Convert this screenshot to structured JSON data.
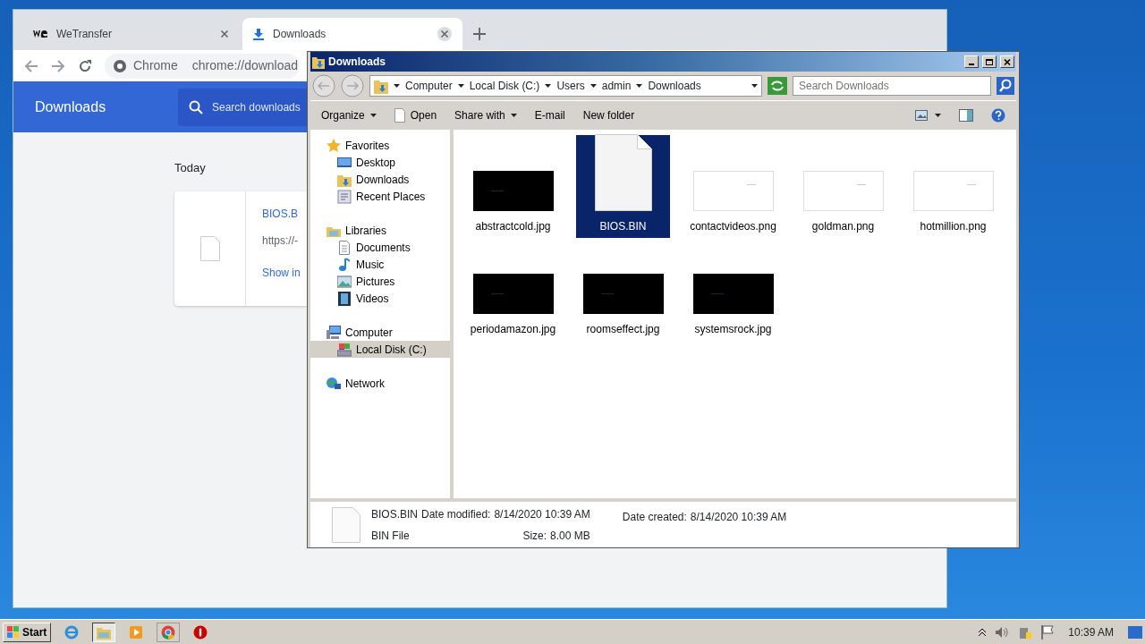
{
  "browser": {
    "tabs": [
      {
        "label": "WeTransfer",
        "kind": "wetransfer",
        "selected": false
      },
      {
        "label": "Downloads",
        "kind": "download",
        "selected": true
      }
    ],
    "address": {
      "scheme": "Chrome",
      "url": "chrome://download"
    },
    "header": {
      "title": "Downloads",
      "search_placeholder": "Search downloads"
    },
    "section": "Today",
    "download": {
      "name": "BIOS.B",
      "url": "https://-",
      "link": "Show in"
    }
  },
  "explorer": {
    "title": "Downloads",
    "breadcrumb": [
      "Computer",
      "Local Disk (C:)",
      "Users",
      "admin",
      "Downloads"
    ],
    "search_placeholder": "Search Downloads",
    "toolbar": [
      {
        "label": "Organize",
        "dropdown": true,
        "kind": "text"
      },
      {
        "label": "Open",
        "dropdown": false,
        "kind": "file"
      },
      {
        "label": "Share with",
        "dropdown": true,
        "kind": "text"
      },
      {
        "label": "E-mail",
        "dropdown": false,
        "kind": "text"
      },
      {
        "label": "New folder",
        "dropdown": false,
        "kind": "text"
      }
    ],
    "nav": [
      {
        "label": "Favorites",
        "kind": "star",
        "selected": false,
        "children": [
          {
            "label": "Desktop",
            "kind": "desktop",
            "selected": false
          },
          {
            "label": "Downloads",
            "kind": "folder",
            "selected": false
          },
          {
            "label": "Recent Places",
            "kind": "recent",
            "selected": false
          }
        ]
      },
      {
        "label": "Libraries",
        "kind": "library",
        "selected": false,
        "children": [
          {
            "label": "Documents",
            "kind": "document",
            "selected": false
          },
          {
            "label": "Music",
            "kind": "music",
            "selected": false
          },
          {
            "label": "Pictures",
            "kind": "pictures",
            "selected": false
          },
          {
            "label": "Videos",
            "kind": "video",
            "selected": false
          }
        ]
      },
      {
        "label": "Computer",
        "kind": "computer",
        "selected": false,
        "children": [
          {
            "label": "Local Disk (C:)",
            "kind": "disk",
            "selected": true
          }
        ]
      },
      {
        "label": "Network",
        "kind": "network",
        "selected": false
      }
    ],
    "files": [
      {
        "name": "abstractcold.jpg",
        "kind": "dark",
        "selected": false
      },
      {
        "name": "BIOS.BIN",
        "kind": "file",
        "selected": true
      },
      {
        "name": "contactvideos.png",
        "kind": "light",
        "selected": false
      },
      {
        "name": "goldman.png",
        "kind": "light",
        "selected": false
      },
      {
        "name": "hotmillion.png",
        "kind": "light",
        "selected": false
      },
      {
        "name": "periodamazon.jpg",
        "kind": "dark",
        "selected": false
      },
      {
        "name": "roomseffect.jpg",
        "kind": "dark",
        "selected": false
      },
      {
        "name": "systemsrock.jpg",
        "kind": "dark",
        "selected": false
      }
    ],
    "details": {
      "name": "BIOS.BIN",
      "type": "BIN File",
      "modified_label": "Date modified:",
      "modified": "8/14/2020 10:39 AM",
      "size_label": "Size:",
      "size": "8.00 MB",
      "created_label": "Date created:",
      "created": "8/14/2020 10:39 AM"
    }
  },
  "taskbar": {
    "start": "Start",
    "clock": "10:39 AM"
  }
}
